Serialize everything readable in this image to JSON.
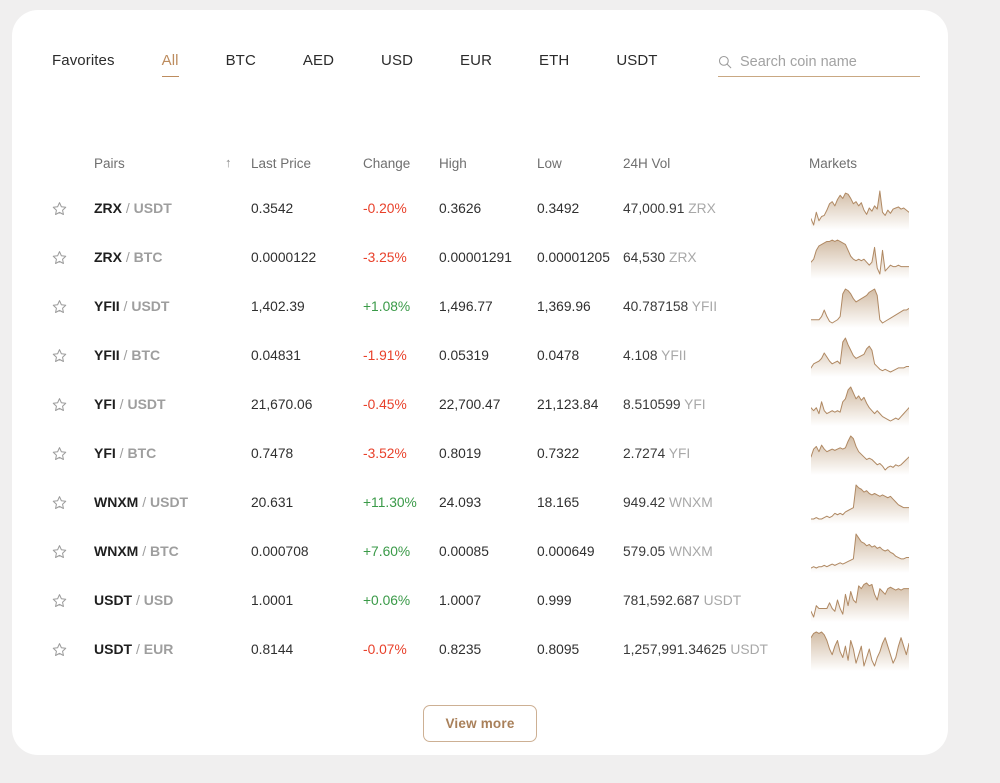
{
  "tabs": [
    {
      "label": "Favorites",
      "active": false
    },
    {
      "label": "All",
      "active": true
    },
    {
      "label": "BTC",
      "active": false
    },
    {
      "label": "AED",
      "active": false
    },
    {
      "label": "USD",
      "active": false
    },
    {
      "label": "EUR",
      "active": false
    },
    {
      "label": "ETH",
      "active": false
    },
    {
      "label": "USDT",
      "active": false
    }
  ],
  "search": {
    "placeholder": "Search coin name",
    "value": "",
    "icon": "search-icon"
  },
  "columns": {
    "pairs": "Pairs",
    "sort": "↑",
    "last_price": "Last Price",
    "change": "Change",
    "high": "High",
    "low": "Low",
    "vol": "24H Vol",
    "markets": "Markets"
  },
  "colors": {
    "accent": "#bd8c5e",
    "up": "#3a9a48",
    "down": "#e8402a",
    "spark_line": "#b08963",
    "page_bg": "#f0efef",
    "card_bg": "#ffffff"
  },
  "footer": {
    "view_more": "View more"
  },
  "rows": [
    {
      "base": "ZRX",
      "quote": "USDT",
      "last_price": "0.3542",
      "change": "-0.20%",
      "direction": "down",
      "high": "0.3626",
      "low": "0.3492",
      "vol_value": "47,000.91",
      "vol_unit": "ZRX",
      "favorite": false,
      "spark": [
        28,
        34,
        22,
        30,
        26,
        25,
        20,
        14,
        12,
        16,
        10,
        6,
        9,
        4,
        5,
        9,
        14,
        12,
        16,
        13,
        20,
        24,
        18,
        21,
        16,
        19,
        2,
        22,
        25,
        20,
        23,
        19,
        18,
        17,
        19,
        18,
        20,
        22
      ]
    },
    {
      "base": "ZRX",
      "quote": "BTC",
      "last_price": "0.0000122",
      "change": "-3.25%",
      "direction": "down",
      "high": "0.00001291",
      "low": "0.00001205",
      "vol_value": "64,530",
      "vol_unit": "ZRX",
      "favorite": false,
      "spark": [
        22,
        20,
        14,
        11,
        10,
        9,
        8,
        8,
        7,
        8,
        7,
        8,
        9,
        10,
        14,
        18,
        20,
        21,
        20,
        21,
        20,
        22,
        24,
        22,
        12,
        26,
        30,
        14,
        28,
        26,
        24,
        25,
        25,
        24,
        25,
        25,
        25,
        25
      ]
    },
    {
      "base": "YFII",
      "quote": "USDT",
      "last_price": "1,402.39",
      "change": "+1.08%",
      "direction": "up",
      "high": "1,496.77",
      "low": "1,369.96",
      "vol_value": "40.787158",
      "vol_unit": "YFII",
      "favorite": false,
      "spark": [
        24,
        24,
        24,
        24,
        22,
        18,
        22,
        25,
        26,
        25,
        24,
        22,
        8,
        5,
        6,
        8,
        11,
        13,
        12,
        11,
        10,
        9,
        7,
        6,
        5,
        9,
        24,
        26,
        25,
        24,
        23,
        22,
        21,
        20,
        19,
        18,
        18,
        17
      ]
    },
    {
      "base": "YFII",
      "quote": "BTC",
      "last_price": "0.04831",
      "change": "-1.91%",
      "direction": "down",
      "high": "0.05319",
      "low": "0.0478",
      "vol_value": "4.108",
      "vol_unit": "YFII",
      "favorite": false,
      "spark": [
        25,
        22,
        21,
        20,
        18,
        14,
        17,
        20,
        22,
        21,
        20,
        22,
        6,
        3,
        8,
        12,
        16,
        18,
        17,
        16,
        15,
        11,
        9,
        12,
        22,
        24,
        26,
        27,
        26,
        27,
        28,
        27,
        26,
        25,
        25,
        25,
        24,
        24
      ]
    },
    {
      "base": "YFI",
      "quote": "USDT",
      "last_price": "21,670.06",
      "change": "-0.45%",
      "direction": "down",
      "high": "22,700.47",
      "low": "21,123.84",
      "vol_value": "8.510599",
      "vol_unit": "YFI",
      "favorite": false,
      "spark": [
        18,
        20,
        18,
        22,
        14,
        20,
        22,
        21,
        20,
        21,
        20,
        21,
        14,
        12,
        6,
        4,
        8,
        12,
        10,
        13,
        11,
        15,
        18,
        20,
        22,
        20,
        22,
        24,
        25,
        26,
        27,
        26,
        25,
        26,
        24,
        22,
        20,
        18
      ]
    },
    {
      "base": "YFI",
      "quote": "BTC",
      "last_price": "0.7478",
      "change": "-3.52%",
      "direction": "down",
      "high": "0.8019",
      "low": "0.7322",
      "vol_value": "2.7274",
      "vol_unit": "YFI",
      "favorite": false,
      "spark": [
        20,
        14,
        12,
        16,
        11,
        14,
        16,
        15,
        14,
        15,
        14,
        13,
        14,
        13,
        8,
        4,
        6,
        12,
        16,
        18,
        20,
        22,
        21,
        22,
        24,
        26,
        25,
        27,
        30,
        28,
        27,
        28,
        26,
        27,
        26,
        24,
        22,
        20
      ]
    },
    {
      "base": "WNXM",
      "quote": "USDT",
      "last_price": "20.631",
      "change": "+11.30%",
      "direction": "up",
      "high": "24.093",
      "low": "18.165",
      "vol_value": "949.42",
      "vol_unit": "WNXM",
      "favorite": false,
      "spark": [
        28,
        28,
        27,
        28,
        28,
        27,
        26,
        27,
        26,
        24,
        25,
        24,
        25,
        23,
        22,
        21,
        20,
        4,
        6,
        7,
        9,
        8,
        10,
        11,
        10,
        11,
        12,
        11,
        12,
        13,
        12,
        14,
        16,
        18,
        19,
        20,
        20,
        20
      ]
    },
    {
      "base": "WNXM",
      "quote": "BTC",
      "last_price": "0.000708",
      "change": "+7.60%",
      "direction": "up",
      "high": "0.00085",
      "low": "0.000649",
      "vol_value": "579.05",
      "vol_unit": "WNXM",
      "favorite": false,
      "spark": [
        29,
        28,
        29,
        28,
        28,
        27,
        28,
        27,
        26,
        27,
        26,
        25,
        26,
        25,
        24,
        23,
        22,
        3,
        6,
        9,
        10,
        12,
        11,
        13,
        12,
        14,
        13,
        15,
        16,
        15,
        17,
        18,
        20,
        21,
        22,
        22,
        21,
        21
      ]
    },
    {
      "base": "USDT",
      "quote": "USD",
      "last_price": "1.0001",
      "change": "+0.06%",
      "direction": "up",
      "high": "1.0007",
      "low": "0.999",
      "vol_value": "781,592.687",
      "vol_unit": "USDT",
      "favorite": false,
      "spark": [
        22,
        26,
        18,
        20,
        20,
        20,
        20,
        16,
        20,
        22,
        14,
        20,
        24,
        10,
        18,
        8,
        14,
        16,
        4,
        6,
        3,
        2,
        4,
        3,
        10,
        14,
        6,
        8,
        10,
        6,
        5,
        6,
        7,
        6,
        7,
        6,
        6,
        6
      ]
    },
    {
      "base": "USDT",
      "quote": "EUR",
      "last_price": "0.8144",
      "change": "-0.07%",
      "direction": "down",
      "high": "0.8235",
      "low": "0.8095",
      "vol_value": "1,257,991.34625",
      "vol_unit": "USDT",
      "favorite": false,
      "spark": [
        8,
        5,
        4,
        5,
        4,
        6,
        10,
        16,
        20,
        14,
        10,
        18,
        22,
        14,
        24,
        10,
        16,
        26,
        20,
        14,
        28,
        22,
        16,
        24,
        28,
        22,
        18,
        12,
        8,
        14,
        20,
        26,
        22,
        14,
        8,
        14,
        20,
        12
      ]
    }
  ]
}
